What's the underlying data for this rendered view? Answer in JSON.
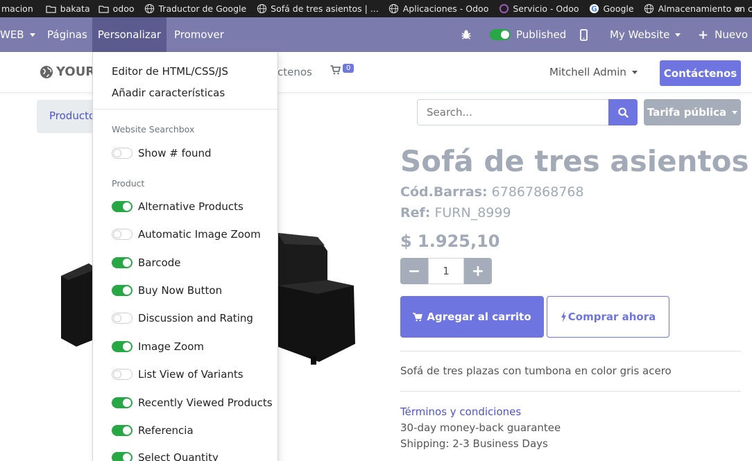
{
  "bookmarks": [
    {
      "label": "macion",
      "icon": "none"
    },
    {
      "label": "bakata",
      "icon": "folder-icon"
    },
    {
      "label": "odoo",
      "icon": "folder-icon"
    },
    {
      "label": "Traductor de Google",
      "icon": "globe-icon"
    },
    {
      "label": "Sofá de tres asientos | ...",
      "icon": "globe-icon"
    },
    {
      "label": "Aplicaciones - Odoo",
      "icon": "globe-icon"
    },
    {
      "label": "Servicio - Odoo",
      "icon": "odoo-icon"
    },
    {
      "label": "Google",
      "icon": "google-icon"
    },
    {
      "label": "Almacenamiento en c...",
      "icon": "globe-icon"
    }
  ],
  "topnav": {
    "web": "WEB",
    "pages": "Páginas",
    "customize": "Personalizar",
    "promote": "Promover",
    "published": "Published",
    "website": "My Website",
    "new": "Nuevo"
  },
  "header": {
    "logo": "YOUR W",
    "menu_fragment": "ctenos",
    "cart_count": "0",
    "user": "Mitchell Admin",
    "contact": "Contáctenos"
  },
  "breadcrumb": "Productos",
  "search": {
    "placeholder": "Search..."
  },
  "pricelist": "Tarifa pública",
  "product": {
    "name": "Sofá de tres asientos",
    "barcode_label": "Cód.Barras:",
    "barcode_value": "67867868768",
    "ref_label": "Ref:",
    "ref_value": "FURN_8999",
    "price": "$ 1.925,10",
    "quantity": "1",
    "add_to_cart": "Agregar al carrito",
    "buy_now": "Comprar ahora",
    "description": "Sofá de tres plazas con tumbona en color gris acero",
    "terms": "Términos y condiciones",
    "guarantee": "30-day money-back guarantee",
    "shipping": "Shipping: 2-3 Business Days"
  },
  "dropdown": {
    "html_editor": "Editor de HTML/CSS/JS",
    "add_features": "Añadir características",
    "section_searchbox": "Website Searchbox",
    "section_product": "Product",
    "show_found": {
      "label": "Show # found",
      "on": false
    },
    "options": [
      {
        "label": "Alternative Products",
        "on": true
      },
      {
        "label": "Automatic Image Zoom",
        "on": false
      },
      {
        "label": "Barcode",
        "on": true
      },
      {
        "label": "Buy Now Button",
        "on": true
      },
      {
        "label": "Discussion and Rating",
        "on": false
      },
      {
        "label": "Image Zoom",
        "on": true
      },
      {
        "label": "List View of Variants",
        "on": false
      },
      {
        "label": "Recently Viewed Products",
        "on": true
      },
      {
        "label": "Referencia",
        "on": true
      },
      {
        "label": "Select Quantity",
        "on": true
      }
    ]
  },
  "colors": {
    "navbar": "#7c7bad",
    "primary": "#6f75e0",
    "toggle_on": "#28a745"
  }
}
